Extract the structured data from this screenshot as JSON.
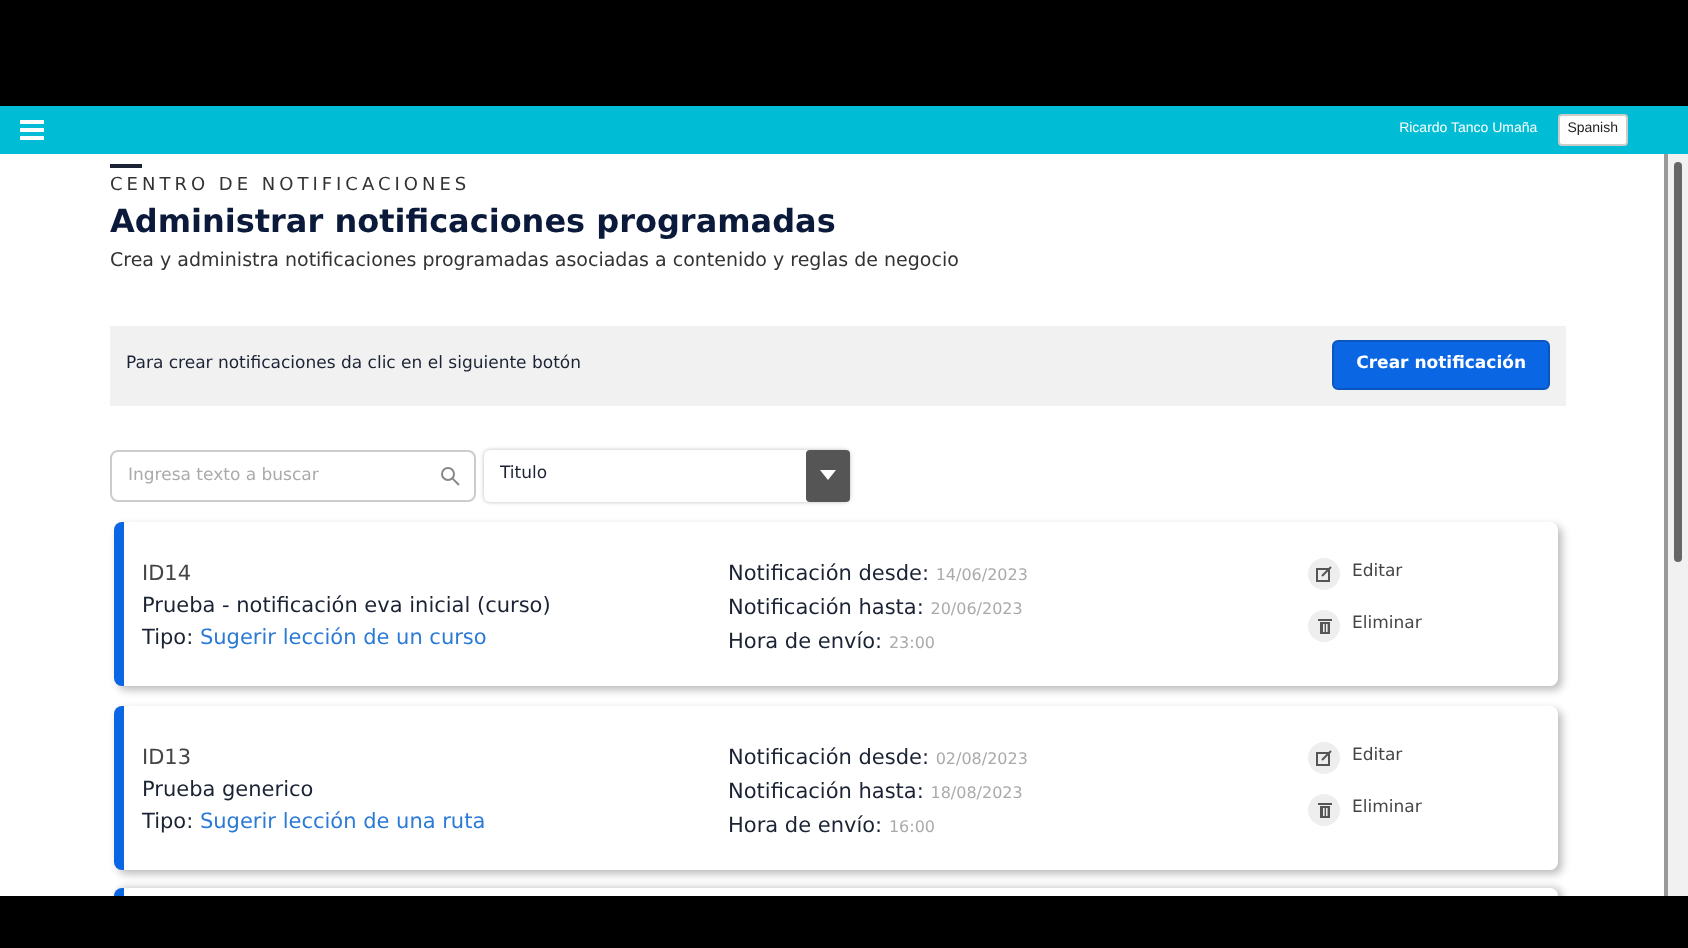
{
  "navbar": {
    "user": "Ricardo Tanco Umaña",
    "language": "Spanish"
  },
  "header": {
    "eyebrow": "CENTRO DE NOTIFICACIONES",
    "title": "Administrar notificaciones programadas",
    "subtitle": "Crea y administra notificaciones programadas asociadas a contenido y reglas de negocio"
  },
  "banner": {
    "text": "Para crear notificaciones da clic en el siguiente botón",
    "button": "Crear notificación"
  },
  "filters": {
    "search_placeholder": "Ingresa texto a buscar",
    "field": "Titulo"
  },
  "notifications": [
    {
      "id": "ID14",
      "title": "Prueba - notificación eva inicial (curso)",
      "type_label": "Tipo:",
      "type": "Sugerir lección de un curso",
      "from_label": "Notificación desde:",
      "from": "14/06/2023",
      "to_label": "Notificación hasta:",
      "to": "20/06/2023",
      "time_label": "Hora de envío:",
      "time": "23:00",
      "edit": "Editar",
      "delete": "Eliminar"
    },
    {
      "id": "ID13",
      "title": "Prueba generico",
      "type_label": "Tipo:",
      "type": "Sugerir lección de una ruta",
      "from_label": "Notificación desde:",
      "from": "02/08/2023",
      "to_label": "Notificación hasta:",
      "to": "18/08/2023",
      "time_label": "Hora de envío:",
      "time": "16:00",
      "edit": "Editar",
      "delete": "Eliminar"
    }
  ]
}
